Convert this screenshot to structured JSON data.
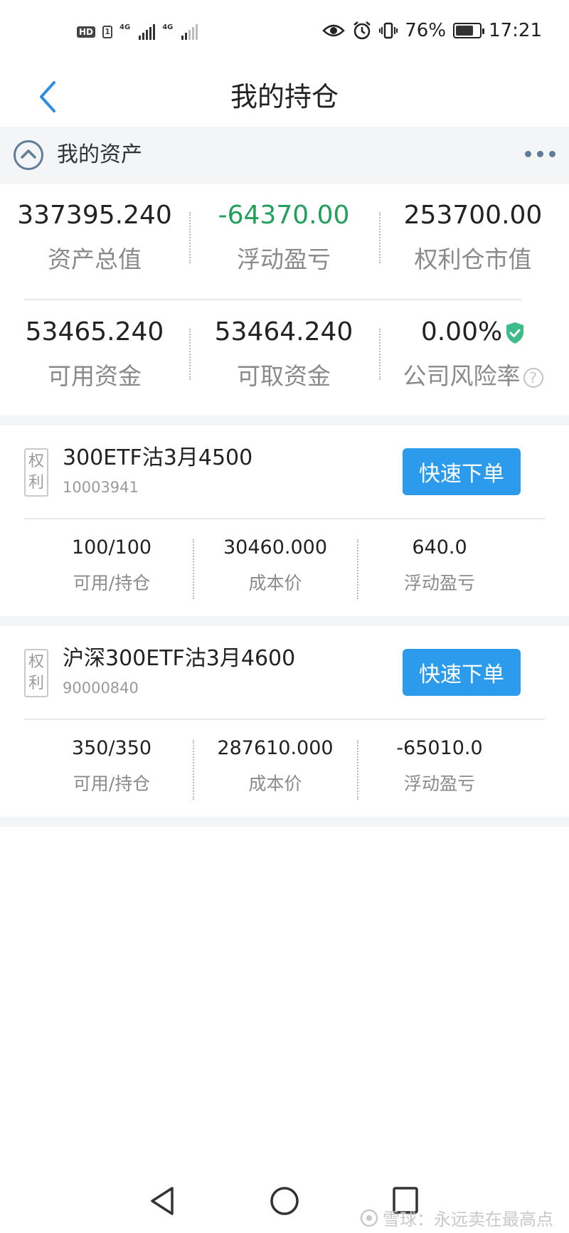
{
  "status_bar": {
    "hd": "HD",
    "sim": "1",
    "net1": "4G",
    "net2": "4G",
    "battery_pct": "76%",
    "battery_level": 0.76,
    "time": "17:21"
  },
  "nav": {
    "title": "我的持仓"
  },
  "assets": {
    "title": "我的资产",
    "row1": [
      {
        "value": "337395.240",
        "label": "资产总值"
      },
      {
        "value": "-64370.00",
        "label": "浮动盈亏"
      },
      {
        "value": "253700.00",
        "label": "权利仓市值"
      }
    ],
    "row2": [
      {
        "value": "53465.240",
        "label": "可用资金"
      },
      {
        "value": "53464.240",
        "label": "可取资金"
      },
      {
        "value": "0.00%",
        "label": "公司风险率"
      }
    ],
    "help": "?"
  },
  "positions": [
    {
      "tag1": "权",
      "tag2": "利",
      "name": "300ETF沽3月4500",
      "code": "10003941",
      "button": "快速下单",
      "qty": "100/100",
      "qty_label": "可用/持仓",
      "cost": "30460.000",
      "cost_label": "成本价",
      "pnl": "640.0",
      "pnl_label": "浮动盈亏"
    },
    {
      "tag1": "权",
      "tag2": "利",
      "name": "沪深300ETF沽3月4600",
      "code": "90000840",
      "button": "快速下单",
      "qty": "350/350",
      "qty_label": "可用/持仓",
      "cost": "287610.000",
      "cost_label": "成本价",
      "pnl": "-65010.0",
      "pnl_label": "浮动盈亏"
    }
  ],
  "watermark": "雪球：永远卖在最高点",
  "colors": {
    "accent": "#2d9bec",
    "profit": "#c4242f",
    "loss": "#21a05c",
    "icon": "#5f7d99"
  }
}
